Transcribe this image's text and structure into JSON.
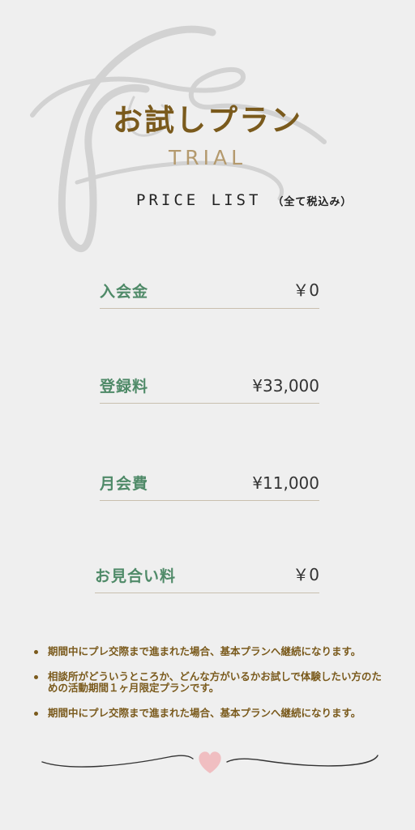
{
  "header": {
    "title": "お試しプラン",
    "subtitle": "TRIAL",
    "price_list_label": "PRICE LIST",
    "price_list_note": "（全て税込み）"
  },
  "fees": [
    {
      "label": "入会金",
      "value": "￥0"
    },
    {
      "label": "登録料",
      "value": "¥33,000"
    },
    {
      "label": "月会費",
      "value": "¥11,000"
    },
    {
      "label": "お見合い料",
      "value": "￥0"
    }
  ],
  "notes": [
    "期間中にプレ交際まで進まれた場合、基本プランへ継続になります。",
    "相談所がどういうところか、どんな方がいるかお試しで体験したい方のための活動期間１ヶ月限定プランです。",
    "期間中にプレ交際まで進まれた場合、基本プランへ継続になります。"
  ],
  "colors": {
    "background": "#efefef",
    "title": "#7a5a1c",
    "subtitle": "#b49a6e",
    "fee_label": "#4f8a68",
    "divider_line": "#c9bfae",
    "heart": "#f0b8bb"
  },
  "icons": {
    "flourish": "calligraphy-swirl-decoration",
    "divider_heart": "heart-icon"
  }
}
